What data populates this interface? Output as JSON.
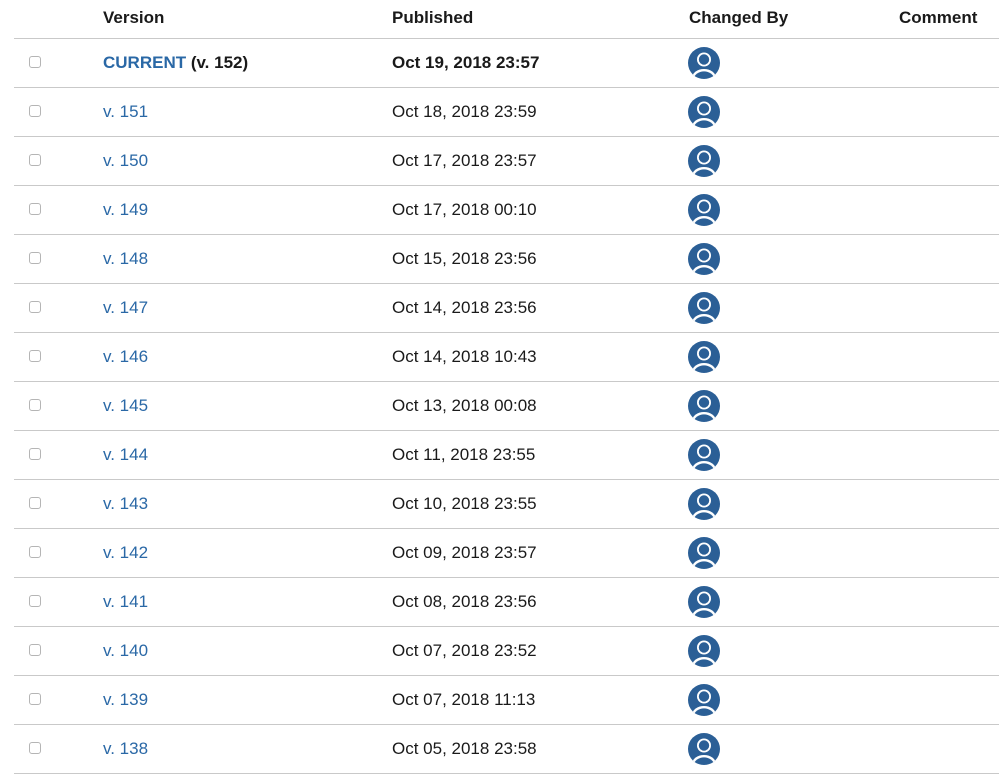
{
  "headers": {
    "version": "Version",
    "published": "Published",
    "changed_by": "Changed By",
    "comment": "Comment"
  },
  "icons": {
    "avatar": "user-avatar-icon",
    "checkbox": "checkbox"
  },
  "colors": {
    "link": "#2a68a6",
    "avatar": "#2b5f96",
    "divider": "#c9c9c9"
  },
  "rows": [
    {
      "version": "CURRENT",
      "version_suffix": " (v. 152)",
      "published": "Oct 19, 2018 23:57",
      "current": true
    },
    {
      "version": "v. 151",
      "version_suffix": "",
      "published": "Oct 18, 2018 23:59"
    },
    {
      "version": "v. 150",
      "version_suffix": "",
      "published": "Oct 17, 2018 23:57"
    },
    {
      "version": "v. 149",
      "version_suffix": "",
      "published": "Oct 17, 2018 00:10"
    },
    {
      "version": "v. 148",
      "version_suffix": "",
      "published": "Oct 15, 2018 23:56"
    },
    {
      "version": "v. 147",
      "version_suffix": "",
      "published": "Oct 14, 2018 23:56"
    },
    {
      "version": "v. 146",
      "version_suffix": "",
      "published": "Oct 14, 2018 10:43"
    },
    {
      "version": "v. 145",
      "version_suffix": "",
      "published": "Oct 13, 2018 00:08"
    },
    {
      "version": "v. 144",
      "version_suffix": "",
      "published": "Oct 11, 2018 23:55"
    },
    {
      "version": "v. 143",
      "version_suffix": "",
      "published": "Oct 10, 2018 23:55"
    },
    {
      "version": "v. 142",
      "version_suffix": "",
      "published": "Oct 09, 2018 23:57"
    },
    {
      "version": "v. 141",
      "version_suffix": "",
      "published": "Oct 08, 2018 23:56"
    },
    {
      "version": "v. 140",
      "version_suffix": "",
      "published": "Oct 07, 2018 23:52"
    },
    {
      "version": "v. 139",
      "version_suffix": "",
      "published": "Oct 07, 2018 11:13"
    },
    {
      "version": "v. 138",
      "version_suffix": "",
      "published": "Oct 05, 2018 23:58"
    }
  ]
}
